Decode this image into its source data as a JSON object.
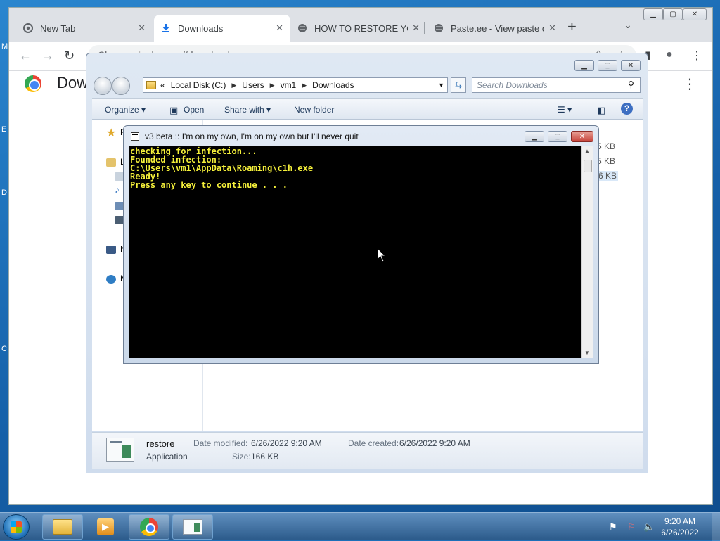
{
  "desktop": {
    "edge_letters": [
      "M",
      "E",
      "D",
      "C"
    ]
  },
  "browser": {
    "tabs": [
      {
        "label": "New Tab",
        "icon": "chrome-icon"
      },
      {
        "label": "Downloads",
        "icon": "download-icon"
      },
      {
        "label": "HOW TO RESTORE YOUR",
        "icon": "globe-icon"
      },
      {
        "label": "Paste.ee - View paste oS",
        "icon": "globe-icon"
      }
    ],
    "address_site": "Chrome",
    "address_url": "chrome://downloads",
    "page_title": "Downl"
  },
  "explorer": {
    "breadcrumb": [
      "«",
      "Local Disk (C:)",
      "Users",
      "vm1",
      "Downloads"
    ],
    "search_placeholder": "Search Downloads",
    "commands": {
      "organize": "Organize ▾",
      "open": "Open",
      "share_with": "Share with ▾",
      "new_folder": "New folder"
    },
    "nav_letters": [
      "F",
      "L",
      "N",
      "N"
    ],
    "visible_sizes": [
      "5 KB",
      "5 KB",
      "6 KB"
    ],
    "details": {
      "name": "restore",
      "type": "Application",
      "date_modified_label": "Date modified:",
      "date_modified": "6/26/2022 9:20 AM",
      "size_label": "Size:",
      "size": "166 KB",
      "date_created_label": "Date created:",
      "date_created": "6/26/2022 9:20 AM"
    }
  },
  "console": {
    "title": "v3 beta :: I'm on my own, I'm on my own but I'll never quit",
    "text_color": "#f5f03a",
    "lines": [
      "checking for infection...",
      "Founded infection:",
      "C:\\Users\\vm1\\AppData\\Roaming\\c1h.exe",
      "Ready!",
      "Press any key to continue . . ."
    ]
  },
  "taskbar": {
    "time": "9:20 AM",
    "date": "6/26/2022",
    "pinned": [
      "windows-explorer",
      "media-player",
      "google-chrome",
      "restore-app"
    ]
  }
}
